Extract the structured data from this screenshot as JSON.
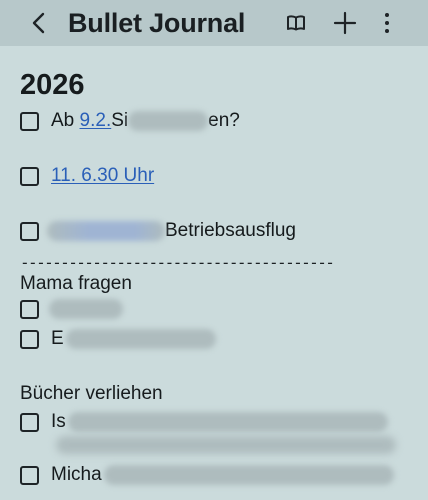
{
  "app_bar": {
    "title": "Bullet Journal",
    "icons": [
      "back-arrow-icon",
      "reading-mode-icon",
      "add-icon",
      "more-options-icon"
    ]
  },
  "note": {
    "heading": "2026",
    "items": [
      {
        "checked": false,
        "prefix": "Ab ",
        "link": "9.2.",
        "mid": " Si",
        "suffix": "en?"
      },
      {
        "checked": false,
        "link": "11. 6.30 Uhr"
      },
      {
        "checked": false,
        "suffix": "Betriebsausflug"
      }
    ],
    "divider": "---------------------------------------",
    "section_mama": {
      "title": "Mama fragen",
      "items": [
        {
          "checked": false,
          "text": ""
        },
        {
          "checked": false,
          "text": "E"
        }
      ]
    },
    "section_books": {
      "title": "Bücher verliehen",
      "items": [
        {
          "checked": false,
          "text": "Is"
        },
        {
          "checked": false,
          "text": "Micha"
        }
      ]
    }
  },
  "colors": {
    "background": "#cbdbdc",
    "app_bar": "#b7c8ca",
    "link": "#2a5fb8",
    "text": "#161b1d"
  }
}
